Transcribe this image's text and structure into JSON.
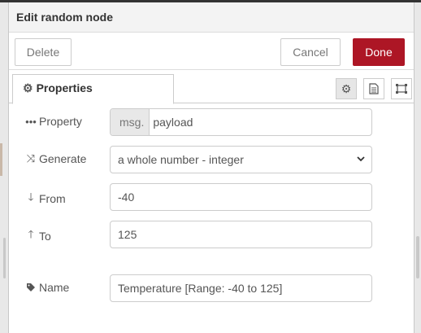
{
  "dialog": {
    "title": "Edit random node"
  },
  "toolbar": {
    "delete_label": "Delete",
    "cancel_label": "Cancel",
    "done_label": "Done",
    "done_color": "#ad1625"
  },
  "tabs": {
    "properties_label": "Properties"
  },
  "tab_icons": [
    "gear-icon",
    "document-icon",
    "frame-icon"
  ],
  "form": {
    "property": {
      "label": "Property",
      "prefix": "msg.",
      "value": "payload",
      "icon": "ellipsis-icon"
    },
    "generate": {
      "label": "Generate",
      "value": "a whole number - integer",
      "icon": "shuffle-icon"
    },
    "from": {
      "label": "From",
      "value": "-40",
      "icon": "arrow-down-icon"
    },
    "to": {
      "label": "To",
      "value": "125",
      "icon": "arrow-up-icon"
    },
    "name": {
      "label": "Name",
      "value": "Temperature [Range: -40 to 125]",
      "icon": "tag-icon"
    }
  }
}
